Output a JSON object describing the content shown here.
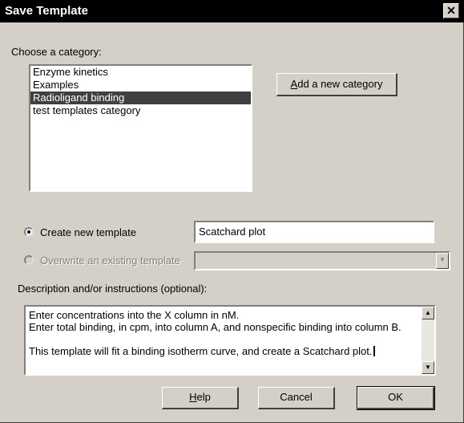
{
  "window": {
    "title": "Save Template",
    "close_glyph": "✕"
  },
  "category": {
    "label": "Choose a category:",
    "items": [
      {
        "label": "Enzyme kinetics",
        "selected": false
      },
      {
        "label": "Examples",
        "selected": false
      },
      {
        "label": "Radioligand binding",
        "selected": true
      },
      {
        "label": "test templates category",
        "selected": false
      }
    ],
    "add_button": "Add a new category"
  },
  "options": {
    "create_new_label": "Create new template",
    "create_new_value": "Scatchard plot",
    "overwrite_label": "Overwrite an existing template",
    "overwrite_value": ""
  },
  "description": {
    "label": "Description and/or instructions (optional):",
    "lines": [
      "Enter concentrations into the X column in nM.",
      "Enter total binding, in cpm, into column A, and nonspecific binding into column B.",
      "",
      "This template will fit a binding isotherm curve, and create a Scatchard plot."
    ]
  },
  "buttons": {
    "help": "Help",
    "cancel": "Cancel",
    "ok": "OK"
  }
}
